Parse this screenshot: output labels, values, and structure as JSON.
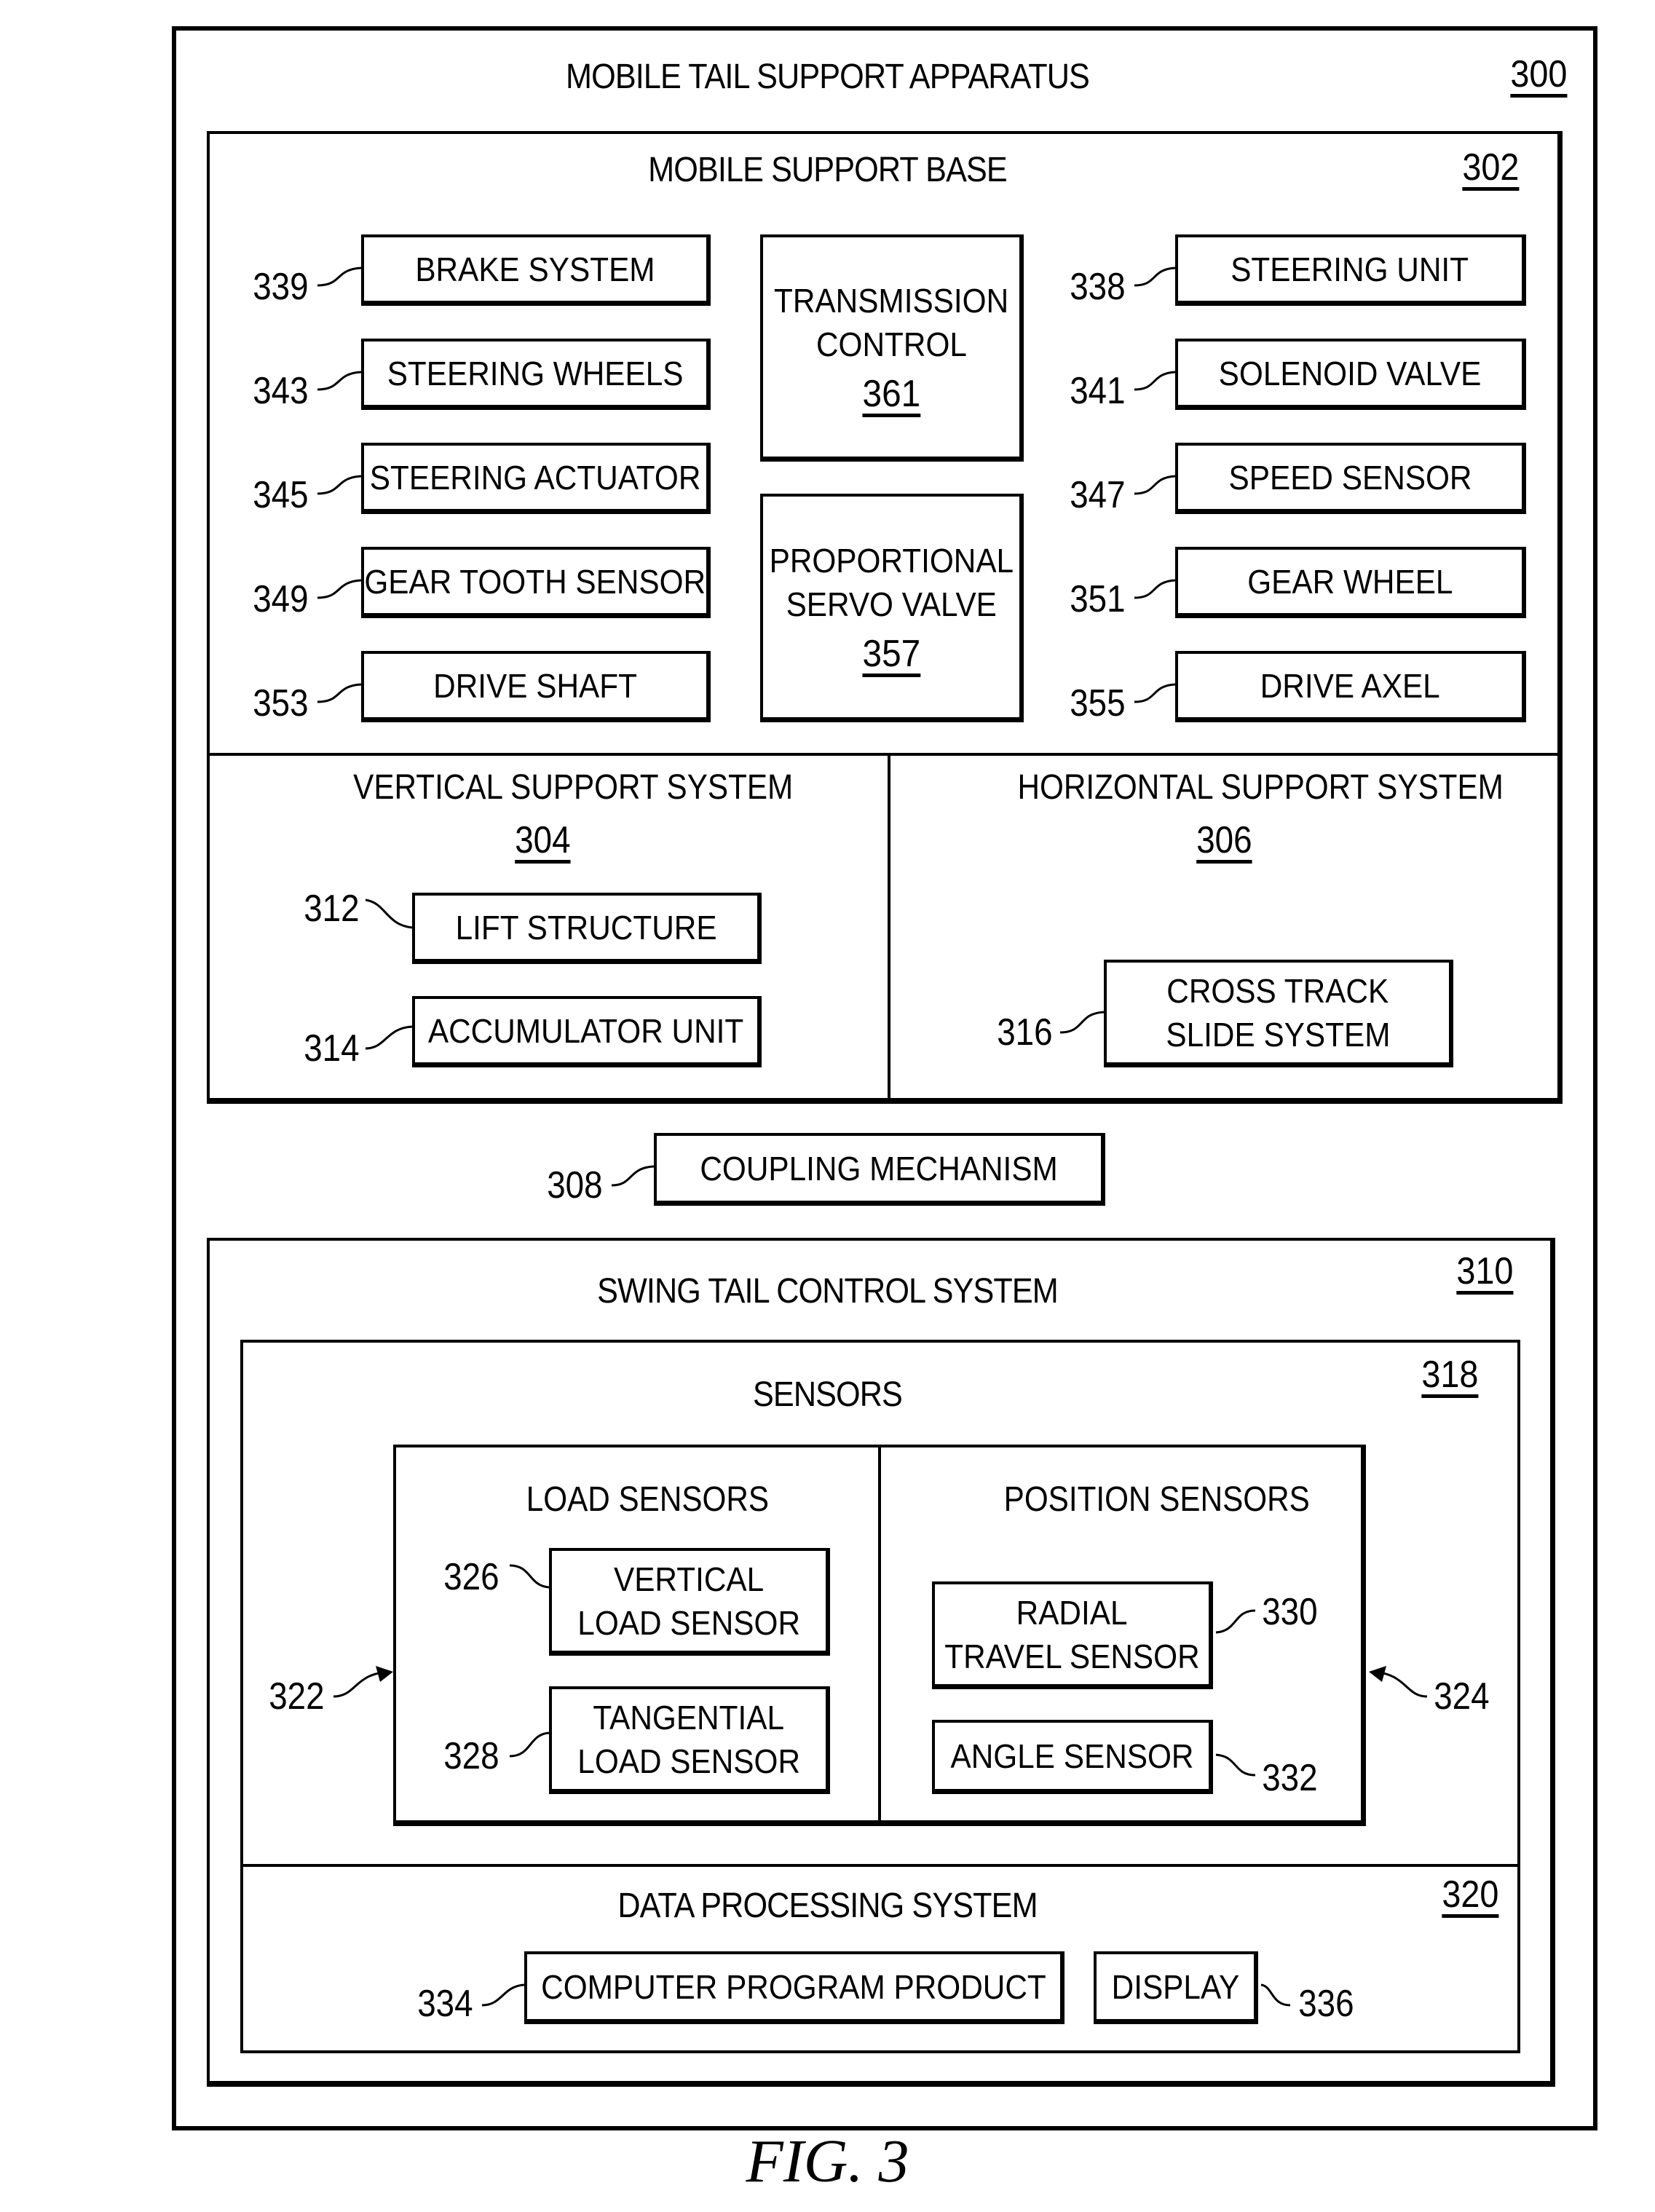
{
  "figure": {
    "caption": "FIG. 3",
    "apparatus": {
      "title": "MOBILE TAIL SUPPORT APPARATUS",
      "ref": "300"
    },
    "mobile_support_base": {
      "title": "MOBILE SUPPORT BASE",
      "ref": "302",
      "left_items": [
        {
          "label": "BRAKE SYSTEM",
          "ref": "339"
        },
        {
          "label": "STEERING WHEELS",
          "ref": "343"
        },
        {
          "label": "STEERING ACTUATOR",
          "ref": "345"
        },
        {
          "label": "GEAR TOOTH SENSOR",
          "ref": "349"
        },
        {
          "label": "DRIVE SHAFT",
          "ref": "353"
        }
      ],
      "center_items": [
        {
          "line1": "TRANSMISSION",
          "line2": "CONTROL",
          "ref": "361"
        },
        {
          "line1": "PROPORTIONAL",
          "line2": "SERVO VALVE",
          "ref": "357"
        }
      ],
      "right_items": [
        {
          "label": "STEERING UNIT",
          "ref": "338"
        },
        {
          "label": "SOLENOID VALVE",
          "ref": "341"
        },
        {
          "label": "SPEED SENSOR",
          "ref": "347"
        },
        {
          "label": "GEAR WHEEL",
          "ref": "351"
        },
        {
          "label": "DRIVE AXEL",
          "ref": "355"
        }
      ]
    },
    "vertical_support_system": {
      "title": "VERTICAL SUPPORT SYSTEM",
      "ref": "304",
      "items": [
        {
          "label": "LIFT STRUCTURE",
          "ref": "312"
        },
        {
          "label": "ACCUMULATOR UNIT",
          "ref": "314"
        }
      ]
    },
    "horizontal_support_system": {
      "title": "HORIZONTAL SUPPORT SYSTEM",
      "ref": "306",
      "items": [
        {
          "line1": "CROSS TRACK",
          "line2": "SLIDE SYSTEM",
          "ref": "316"
        }
      ]
    },
    "coupling_mechanism": {
      "label": "COUPLING MECHANISM",
      "ref": "308"
    },
    "swing_tail_control_system": {
      "title": "SWING TAIL CONTROL SYSTEM",
      "ref": "310",
      "sensors": {
        "title": "SENSORS",
        "ref": "318",
        "load_sensors": {
          "title": "LOAD SENSORS",
          "ref": "322",
          "items": [
            {
              "line1": "VERTICAL",
              "line2": "LOAD SENSOR",
              "ref": "326"
            },
            {
              "line1": "TANGENTIAL",
              "line2": "LOAD SENSOR",
              "ref": "328"
            }
          ]
        },
        "position_sensors": {
          "title": "POSITION SENSORS",
          "ref": "324",
          "items": [
            {
              "line1": "RADIAL",
              "line2": "TRAVEL SENSOR",
              "ref": "330"
            },
            {
              "label": "ANGLE SENSOR",
              "ref": "332"
            }
          ]
        }
      },
      "data_processing_system": {
        "title": "DATA PROCESSING SYSTEM",
        "ref": "320",
        "items": [
          {
            "label": "COMPUTER PROGRAM PRODUCT",
            "ref": "334"
          },
          {
            "label": "DISPLAY",
            "ref": "336"
          }
        ]
      }
    }
  }
}
